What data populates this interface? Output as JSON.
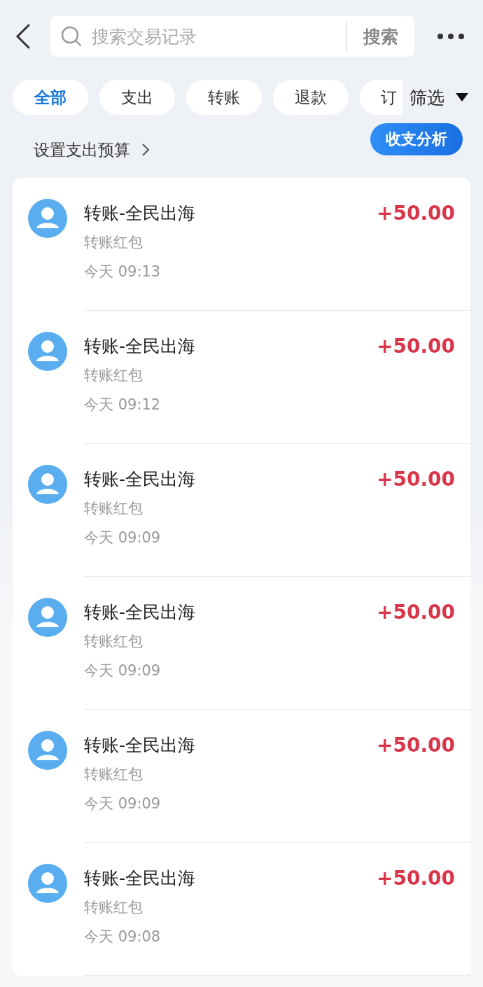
{
  "search": {
    "placeholder": "搜索交易记录",
    "button": "搜索"
  },
  "tabs": [
    {
      "label": "全部",
      "selected": true
    },
    {
      "label": "支出",
      "selected": false
    },
    {
      "label": "转账",
      "selected": false
    },
    {
      "label": "退款",
      "selected": false
    },
    {
      "label": "订",
      "selected": false
    }
  ],
  "filter": "筛选",
  "budget_link": "设置支出预算",
  "analysis_button": "收支分析",
  "transactions": [
    {
      "title": "转账-全民出海",
      "subtitle": "转账红包",
      "time": "今天 09:13",
      "amount": "+50.00"
    },
    {
      "title": "转账-全民出海",
      "subtitle": "转账红包",
      "time": "今天 09:12",
      "amount": "+50.00"
    },
    {
      "title": "转账-全民出海",
      "subtitle": "转账红包",
      "time": "今天 09:09",
      "amount": "+50.00"
    },
    {
      "title": "转账-全民出海",
      "subtitle": "转账红包",
      "time": "今天 09:09",
      "amount": "+50.00"
    },
    {
      "title": "转账-全民出海",
      "subtitle": "转账红包",
      "time": "今天 09:09",
      "amount": "+50.00"
    },
    {
      "title": "转账-全民出海",
      "subtitle": "转账红包",
      "time": "今天 09:08",
      "amount": "+50.00"
    }
  ]
}
